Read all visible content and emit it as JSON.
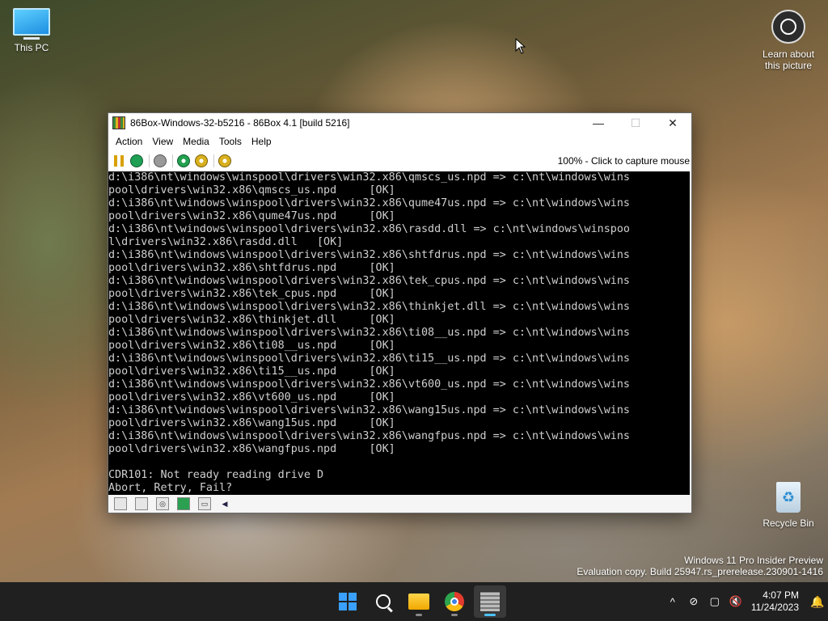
{
  "desktop": {
    "this_pc_label": "This PC",
    "learn_label_1": "Learn about",
    "learn_label_2": "this picture",
    "recycle_bin_label": "Recycle Bin",
    "watermark_line1": "Windows 11 Pro Insider Preview",
    "watermark_line2": "Evaluation copy. Build 25947.rs_prerelease.230901-1416"
  },
  "window": {
    "title": "86Box-Windows-32-b5216 - 86Box 4.1 [build 5216]",
    "minimize_glyph": "—",
    "maximize_glyph": "☐",
    "close_glyph": "✕",
    "menu": [
      "Action",
      "View",
      "Media",
      "Tools",
      "Help"
    ],
    "toolbar_status": "100% - Click to capture mouse",
    "screen_lines": [
      "d:\\i386\\nt\\windows\\winspool\\drivers\\win32.x86\\qmscs_us.npd => c:\\nt\\windows\\wins",
      "pool\\drivers\\win32.x86\\qmscs_us.npd     [OK]",
      "d:\\i386\\nt\\windows\\winspool\\drivers\\win32.x86\\qume47us.npd => c:\\nt\\windows\\wins",
      "pool\\drivers\\win32.x86\\qume47us.npd     [OK]",
      "d:\\i386\\nt\\windows\\winspool\\drivers\\win32.x86\\rasdd.dll => c:\\nt\\windows\\winspoo",
      "l\\drivers\\win32.x86\\rasdd.dll   [OK]",
      "d:\\i386\\nt\\windows\\winspool\\drivers\\win32.x86\\shtfdrus.npd => c:\\nt\\windows\\wins",
      "pool\\drivers\\win32.x86\\shtfdrus.npd     [OK]",
      "d:\\i386\\nt\\windows\\winspool\\drivers\\win32.x86\\tek_cpus.npd => c:\\nt\\windows\\wins",
      "pool\\drivers\\win32.x86\\tek_cpus.npd     [OK]",
      "d:\\i386\\nt\\windows\\winspool\\drivers\\win32.x86\\thinkjet.dll => c:\\nt\\windows\\wins",
      "pool\\drivers\\win32.x86\\thinkjet.dll     [OK]",
      "d:\\i386\\nt\\windows\\winspool\\drivers\\win32.x86\\ti08__us.npd => c:\\nt\\windows\\wins",
      "pool\\drivers\\win32.x86\\ti08__us.npd     [OK]",
      "d:\\i386\\nt\\windows\\winspool\\drivers\\win32.x86\\ti15__us.npd => c:\\nt\\windows\\wins",
      "pool\\drivers\\win32.x86\\ti15__us.npd     [OK]",
      "d:\\i386\\nt\\windows\\winspool\\drivers\\win32.x86\\vt600_us.npd => c:\\nt\\windows\\wins",
      "pool\\drivers\\win32.x86\\vt600_us.npd     [OK]",
      "d:\\i386\\nt\\windows\\winspool\\drivers\\win32.x86\\wang15us.npd => c:\\nt\\windows\\wins",
      "pool\\drivers\\win32.x86\\wang15us.npd     [OK]",
      "d:\\i386\\nt\\windows\\winspool\\drivers\\win32.x86\\wangfpus.npd => c:\\nt\\windows\\wins",
      "pool\\drivers\\win32.x86\\wangfpus.npd     [OK]",
      "",
      "CDR101: Not ready reading drive D",
      "Abort, Retry, Fail?"
    ]
  },
  "taskbar": {
    "time": "4:07 PM",
    "date": "11/24/2023",
    "chevron_glyph": "^"
  },
  "icons": {
    "desktop": [
      "this-pc-icon",
      "learn-about-picture-icon",
      "recycle-bin-icon"
    ],
    "toolbar": [
      "pause-icon",
      "reset-icon",
      "power-icon",
      "settings-icon",
      "settings-alt-icon",
      "media-icon"
    ],
    "statusbar": [
      "floppy1-icon",
      "floppy2-icon",
      "cdrom-icon",
      "network-icon",
      "keyboard-icon",
      "sound-icon"
    ],
    "taskbar": [
      "start-icon",
      "search-icon",
      "file-explorer-icon",
      "chrome-icon",
      "86box-icon"
    ],
    "tray": [
      "network-off-icon",
      "display-icon",
      "volume-mute-icon",
      "notification-bell-icon"
    ]
  }
}
